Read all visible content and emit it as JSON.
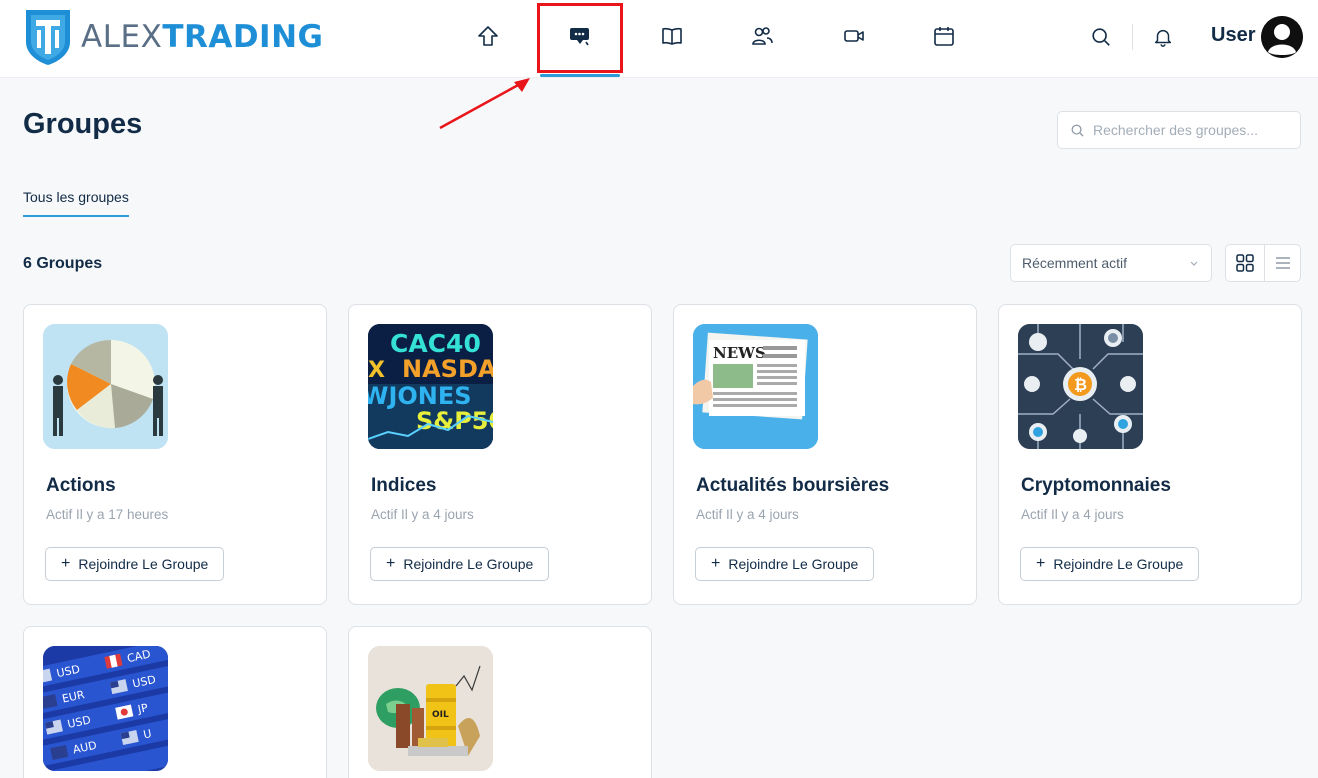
{
  "header": {
    "logo_prefix": "ALEX",
    "logo_suffix": "TRADING",
    "nav": [
      "home-icon",
      "chat-icon",
      "book-icon",
      "users-icon",
      "video-icon",
      "calendar-icon"
    ],
    "active_nav": "chat-icon",
    "user_label": "User"
  },
  "page": {
    "title": "Groupes",
    "search_placeholder": "Rechercher des groupes...",
    "tab_label": "Tous les groupes",
    "count_label": "6 Groupes",
    "sort_value": "Récemment actif"
  },
  "groups": [
    {
      "title": "Actions",
      "meta": "Actif Il y a 17 heures",
      "button": "Rejoindre Le Groupe"
    },
    {
      "title": "Indices",
      "meta": "Actif Il y a 4 jours",
      "button": "Rejoindre Le Groupe",
      "image_text": [
        "CAC40",
        "NASDA",
        "WJONES",
        "S&P50",
        "X"
      ]
    },
    {
      "title": "Actualités boursières",
      "meta": "Actif Il y a 4 jours",
      "button": "Rejoindre Le Groupe",
      "image_text": [
        "NEWS"
      ]
    },
    {
      "title": "Cryptomonnaies",
      "meta": "Actif Il y a 4 jours",
      "button": "Rejoindre Le Groupe"
    },
    {
      "title": "",
      "meta": "",
      "button": "",
      "image_text": [
        "USD",
        "CAD",
        "EUR",
        "USD",
        "USD",
        "JP",
        "AUD",
        "U"
      ]
    },
    {
      "title": "",
      "meta": "",
      "button": "",
      "image_text": [
        "OIL"
      ]
    }
  ],
  "colors": {
    "accent": "#2d9bd8",
    "highlight": "#e8161b",
    "text": "#122b46",
    "muted": "#9aa4af"
  }
}
